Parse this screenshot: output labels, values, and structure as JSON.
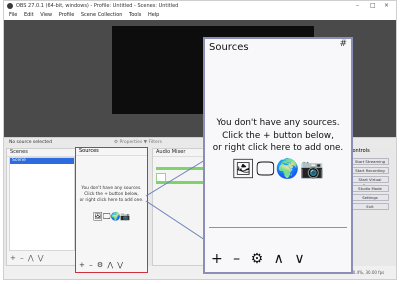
{
  "window": {
    "title": "OBS 27.0.1 (64-bit, windows) - Profile: Untitled - Scenes: Untitled",
    "controls": [
      "–",
      "□",
      "×"
    ]
  },
  "menu": [
    "File",
    "Edit",
    "View",
    "Profile",
    "Scene Collection",
    "Tools",
    "Help"
  ],
  "preview_bar": {
    "status": "No source selected",
    "props": "⚙ Properties  ▼ Filters"
  },
  "scenes": {
    "title": "Scenes",
    "items": [
      "Scene"
    ],
    "footer": "+ –  ⋀ ⋁"
  },
  "sources_small": {
    "title": "Sources",
    "msg": [
      "You don't have any sources.",
      "Click the + button below,",
      "or right click here to add one."
    ],
    "icons": "🖼🖵🌍📷",
    "footer": "+ – ⚙ ⋀ ⋁"
  },
  "mixer": {
    "title": "Audio Mixer"
  },
  "controls": {
    "title": "Controls",
    "buttons": [
      "Start Streaming",
      "Start Recording",
      "Start Virtual Camera",
      "Studio Mode",
      "Settings",
      "Exit"
    ]
  },
  "status": {
    "live": "LIVE: 00:00:00",
    "rec": "REC: 00:00:00",
    "cpu": "CPU: 0.4%, 30.00 fps"
  },
  "sources_popup": {
    "title": "Sources",
    "float_icon": "#",
    "msg": [
      "You don't have any sources.",
      "Click the + button below,",
      "or right click here to add one."
    ],
    "icons": "🖼🖵🌍📷",
    "footer": "+ – ⚙ ∧ ∨"
  },
  "colors": {
    "accent": "#2d6cdf",
    "highlight": "#d0303c",
    "popup_border": "#8a8fb8"
  }
}
